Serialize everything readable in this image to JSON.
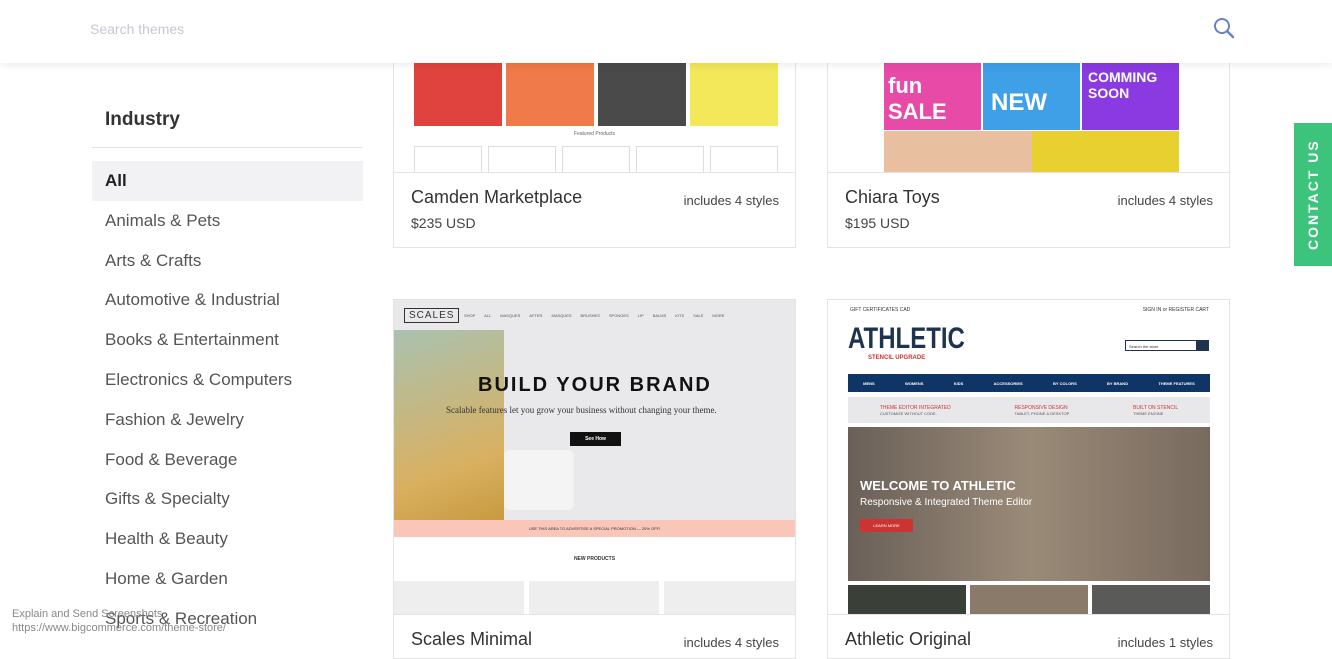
{
  "header": {
    "search_placeholder": "Search themes",
    "search_icon": "search-icon",
    "search_icon_color": "#6a80c4"
  },
  "sidebar": {
    "heading": "Industry",
    "items": [
      {
        "label": "All",
        "active": true
      },
      {
        "label": "Animals & Pets"
      },
      {
        "label": "Arts & Crafts"
      },
      {
        "label": "Automotive & Industrial"
      },
      {
        "label": "Books & Entertainment"
      },
      {
        "label": "Electronics & Computers"
      },
      {
        "label": "Fashion & Jewelry"
      },
      {
        "label": "Food & Beverage"
      },
      {
        "label": "Gifts & Specialty"
      },
      {
        "label": "Health & Beauty"
      },
      {
        "label": "Home & Garden"
      },
      {
        "label": "Sports & Recreation"
      }
    ]
  },
  "themes": [
    {
      "name": "Camden Marketplace",
      "price": "$235 USD",
      "styles": "includes 4 styles",
      "preview": {
        "section": "Featured Products"
      }
    },
    {
      "name": "Chiara Toys",
      "price": "$195 USD",
      "styles": "includes 4 styles",
      "preview": {
        "banners": [
          "fun SALE",
          "NEW",
          "COMMING SOON"
        ]
      }
    },
    {
      "name": "Scales Minimal",
      "styles": "includes 4 styles",
      "preview": {
        "logo": "SCALES",
        "nav": [
          "SHOP ALL",
          "MASQUES",
          "AFTER MASQUES",
          "BRUSHES",
          "SPONGES",
          "LIP BALMS",
          "KITS",
          "SALE",
          "MORE"
        ],
        "headline": "BUILD YOUR BRAND",
        "subline": "Scalable features let you grow your business without changing your theme.",
        "cta": "See How",
        "promo": "USE THIS AREA TO ADVERTISE A SPECIAL PROMOTION — 20% OFF!",
        "section": "NEW PRODUCTS"
      }
    },
    {
      "name": "Athletic Original",
      "styles": "includes 1 styles",
      "preview": {
        "topbar_left": "GIFT CERTIFICATES   CAD",
        "topbar_right": "SIGN IN or REGISTER   CART",
        "logo": "ATHLETIC",
        "logo_sub": "STENCIL UPGRADE",
        "search": "Search the store",
        "nav": [
          "MENS",
          "WOMENS",
          "KIDS",
          "ACCESSORIES",
          "BY COLORS",
          "BY BRAND",
          "THEME FEATURES"
        ],
        "features": [
          {
            "title": "THEME EDITOR INTEGRATED",
            "sub": "CUSTOMIZE WITHOUT CODE."
          },
          {
            "title": "RESPONSIVE DESIGN",
            "sub": "TABLET, PHONE & DESKTOP"
          },
          {
            "title": "BUILT ON STENCIL",
            "sub": "THEME ENGINE"
          }
        ],
        "hero_title": "WELCOME TO ATHLETIC",
        "hero_sub": "Responsive & Integrated Theme Editor",
        "hero_cta": "LEARN MORE"
      }
    }
  ],
  "contact": {
    "label": "CONTACT US",
    "color": "#3cc47c"
  },
  "overlay": {
    "line1": "Explain and Send Screenshots",
    "line2": "https://www.bigcommerce.com/theme-store/"
  }
}
